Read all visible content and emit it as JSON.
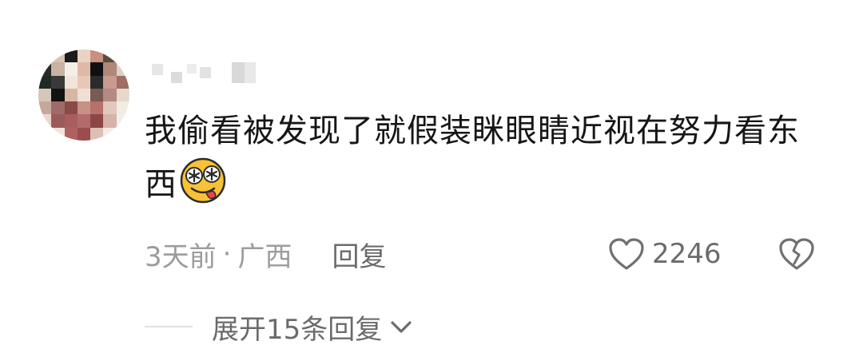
{
  "comment": {
    "username": "用户",
    "text": "我偷看被发现了就假装眯眼睛近视在努力看东西",
    "emoji": "drooling-face",
    "time": "3天前",
    "separator": "·",
    "location": "广西",
    "reply_label": "回复",
    "like_count": "2246",
    "expand_label": "展开15条回复"
  },
  "colors": {
    "text": "#161616",
    "meta": "#9c9c9c",
    "action": "#6b6b6b",
    "divider": "#e1e1e1",
    "emoji_face": "#f7c233"
  }
}
